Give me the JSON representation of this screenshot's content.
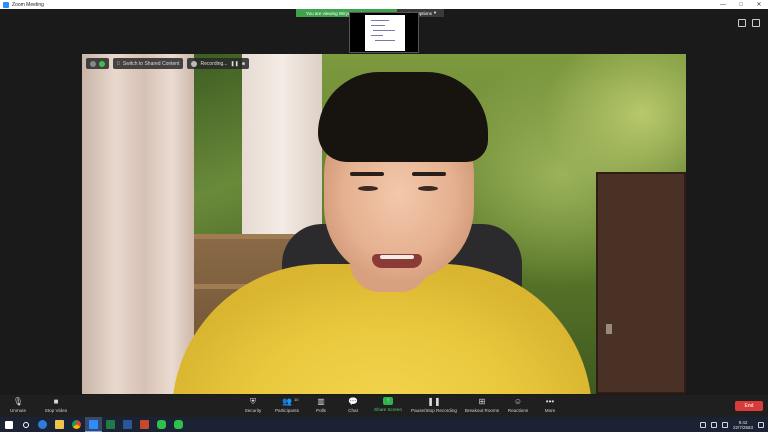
{
  "window": {
    "title": "Zoom Meeting",
    "controls": [
      "minimize",
      "maximize",
      "close"
    ]
  },
  "share": {
    "banner_text": "You are viewing Wirya Panthum's screen",
    "options_label": "View Options"
  },
  "video_overlay": {
    "switch_label": "Switch to Shared Content",
    "recording_label": "Recording..."
  },
  "toolbar": {
    "unmute_label": "Unmute",
    "stop_video_label": "Stop Video",
    "security_label": "Security",
    "participants_label": "Participants",
    "participants_count": "10",
    "polls_label": "Polls",
    "chat_label": "Chat",
    "share_screen_label": "Share Screen",
    "recording_label": "Pause/Stop Recording",
    "breakout_label": "Breakout Rooms",
    "reactions_label": "Reactions",
    "more_label": "More",
    "end_label": "End"
  },
  "taskbar": {
    "apps": [
      "start",
      "search",
      "edge",
      "file-explorer",
      "chrome",
      "zoom",
      "excel",
      "word",
      "powerpoint",
      "line",
      "line-2"
    ],
    "clock_time": "9:42",
    "clock_date": "22/7/2563"
  },
  "colors": {
    "accent_green": "#3fa34d",
    "end_red": "#d93a3a",
    "shirt_yellow": "#f3d54e",
    "toolbar_bg": "#1f1f1f"
  }
}
